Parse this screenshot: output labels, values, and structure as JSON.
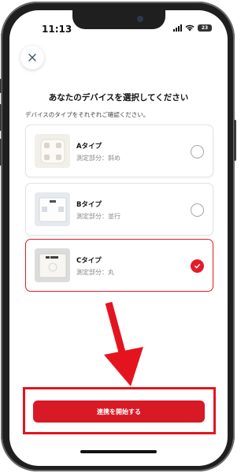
{
  "status_bar": {
    "time": "11:13",
    "battery": "23"
  },
  "modal": {
    "title": "あなたのデバイスを選択してください",
    "subtitle": "デバイスのタイプをそれぞれご確認ください。",
    "devices": [
      {
        "name": "Aタイプ",
        "part": "測定部分：斜め",
        "selected": false,
        "icon": "round-scale-icon"
      },
      {
        "name": "Bタイプ",
        "part": "測定部分：並行",
        "selected": false,
        "icon": "square-scale-icon"
      },
      {
        "name": "Cタイプ",
        "part": "測定部分：丸",
        "selected": true,
        "icon": "square-scale-icon"
      }
    ],
    "start_button": "連携を開始する"
  },
  "colors": {
    "accent": "#e21c2a",
    "annotation": "#e4141f"
  }
}
